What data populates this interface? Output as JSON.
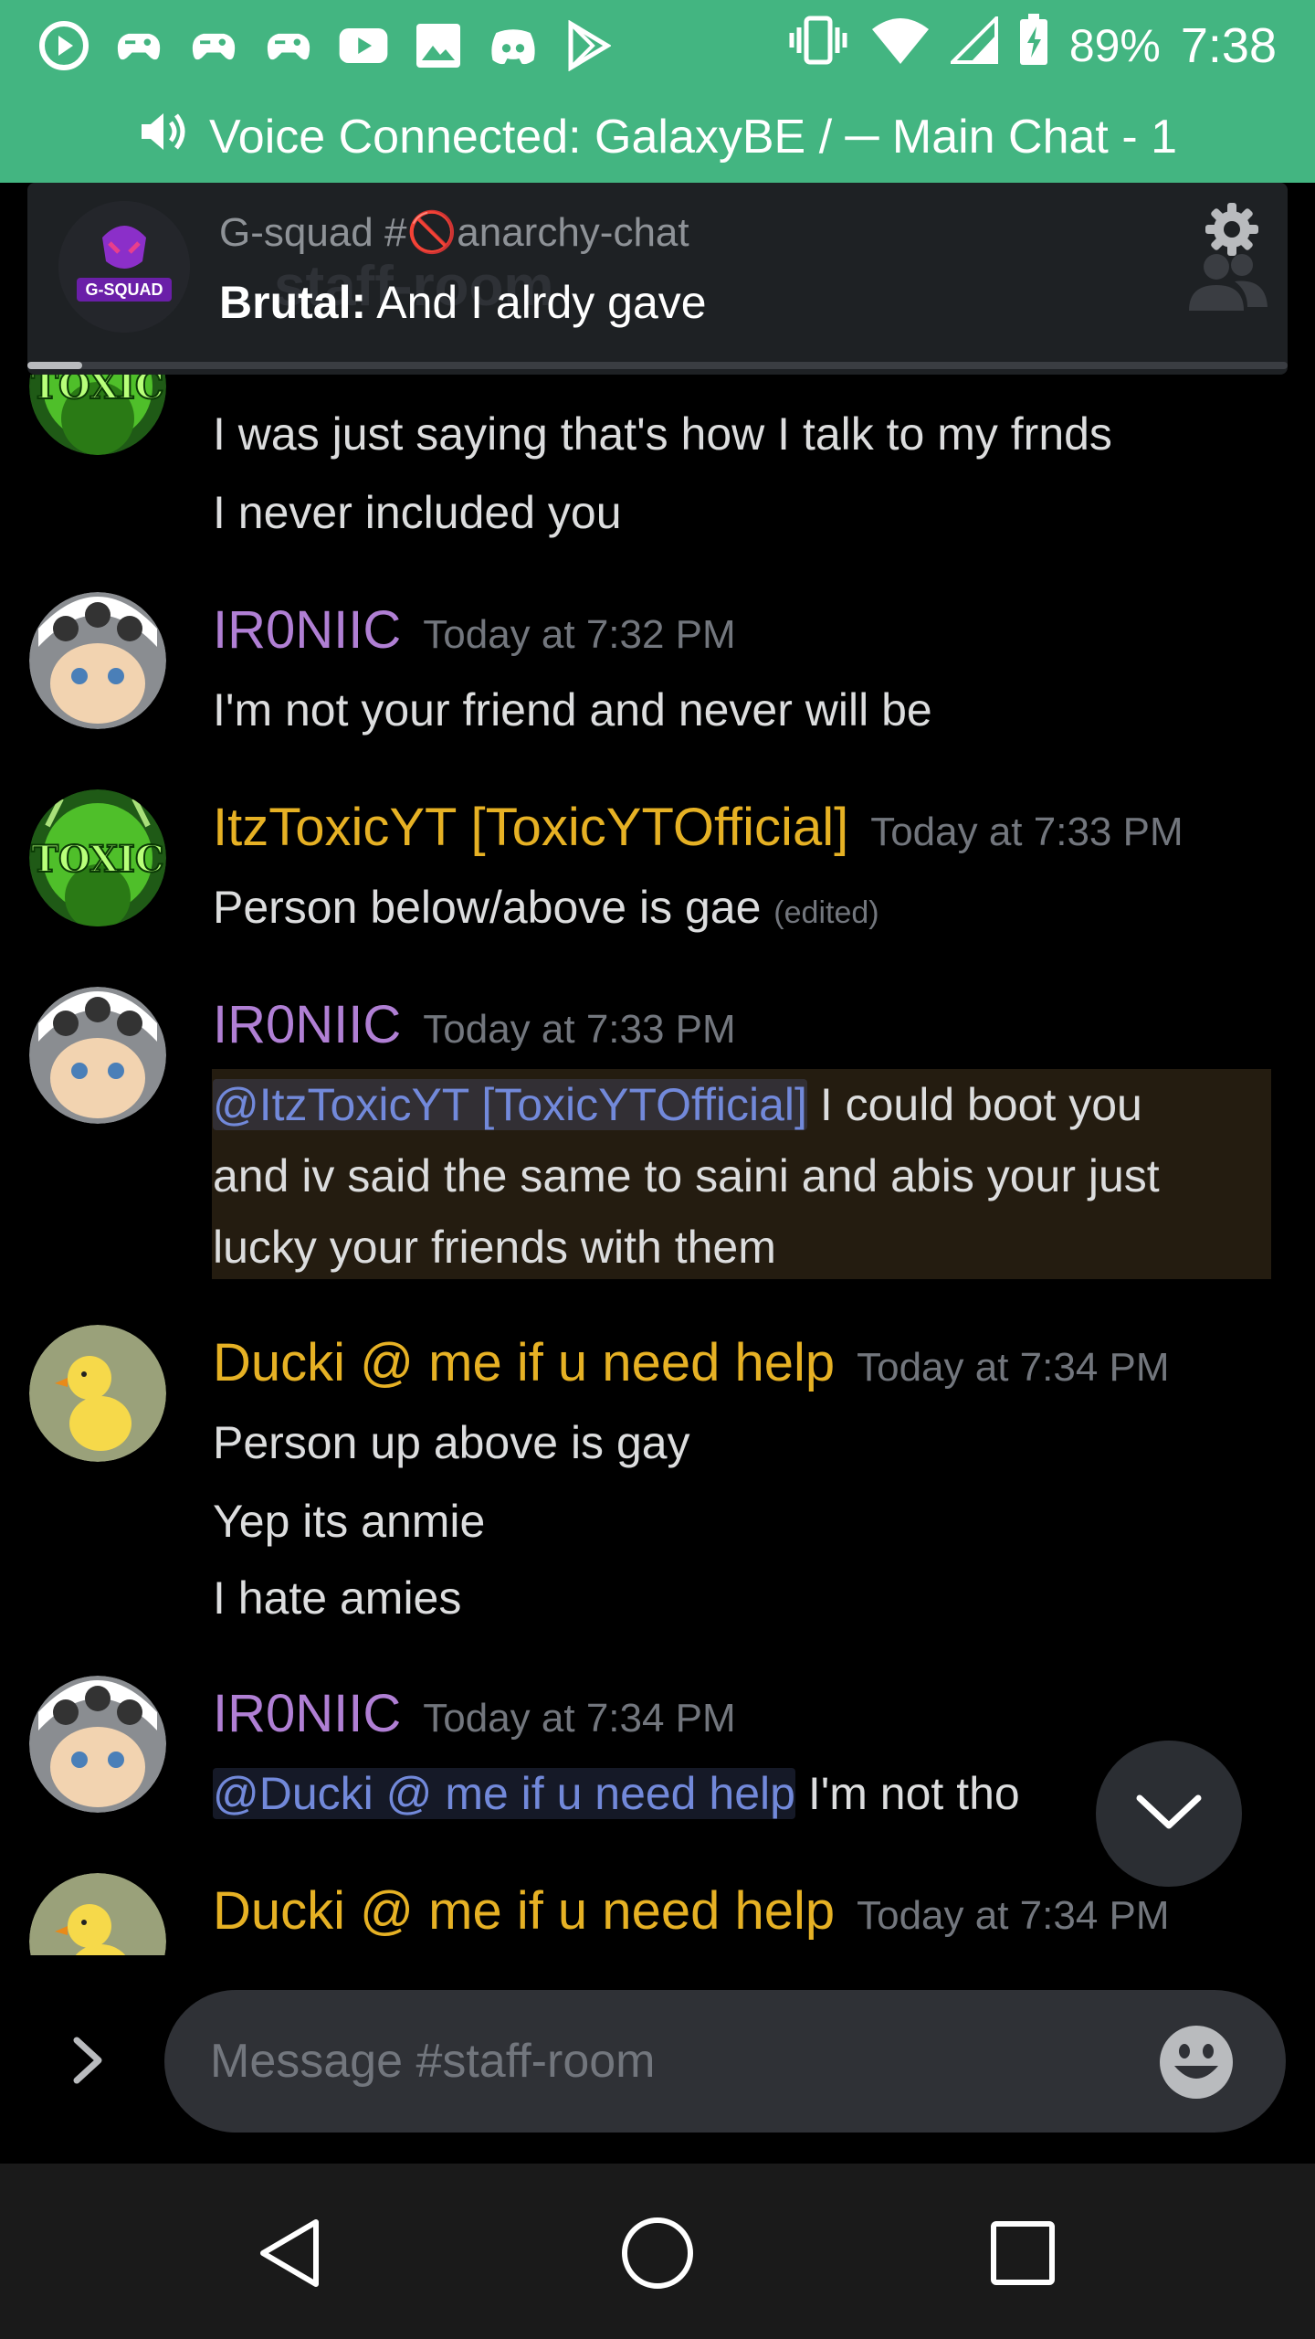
{
  "status_bar": {
    "battery": "89%",
    "time": "7:38",
    "icons": [
      "circle-play-icon",
      "controller-icon",
      "controller-icon",
      "controller-icon",
      "youtube-icon",
      "image-icon",
      "discord-icon",
      "play-store-icon",
      "vibrate-icon",
      "wifi-icon",
      "signal-icon",
      "battery-charging-icon"
    ]
  },
  "voice_banner": {
    "text": "Voice Connected: GalaxyBE / ─ Main Chat - 1"
  },
  "header": {
    "ghost_channel": "staff-room",
    "notification": {
      "server": "G-squad",
      "channel": "#🚫anarchy-chat",
      "author": "Brutal:",
      "text": "And I alrdy gave"
    },
    "server_avatar_text": "G-SQUAD"
  },
  "messages": [
    {
      "lines": [
        "I was just saying that's how I talk to my frnds",
        "I never included you"
      ],
      "avatar_text": "TOXIC"
    },
    {
      "author": "IR0NIIC",
      "time": "Today at 7:32 PM",
      "lines": [
        "I'm not your friend and never will be"
      ]
    },
    {
      "author": "ItzToxicYT [ToxicYTOfficial]",
      "time": "Today at 7:33 PM",
      "lines": [
        "Person below/above is gae"
      ],
      "edited": "(edited)",
      "avatar_text": "TOXIC"
    },
    {
      "author": "IR0NIIC",
      "time": "Today at 7:33 PM",
      "mention": "@ItzToxicYT [ToxicYTOfficial]",
      "lines": [
        " I could boot you",
        "and iv said the same to saini and abis your just",
        "lucky your friends with them"
      ]
    },
    {
      "author": "Ducki @ me if u need help",
      "time": "Today at 7:34 PM",
      "lines": [
        "Person up above is gay",
        "Yep its anmie",
        "I hate amies"
      ]
    },
    {
      "author": "IR0NIIC",
      "time": "Today at 7:34 PM",
      "mention": "@Ducki @ me if u need help",
      "lines": [
        " I'm not tho"
      ]
    },
    {
      "author": "Ducki @ me if u need help",
      "time": "Today at 7:34 PM"
    }
  ],
  "composer": {
    "placeholder": "Message #staff-room"
  },
  "colors": {
    "voice_green": "#43b581",
    "ironiic": "#b07fd4",
    "gold": "#e6b124",
    "mention": "#7289da"
  }
}
